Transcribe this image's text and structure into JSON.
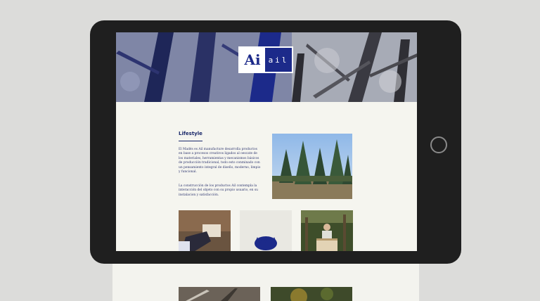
{
  "logo": {
    "mark": "Ai",
    "wordmark": "ail"
  },
  "section": {
    "heading": "Lifestyle",
    "paragraph_1": "El Madés es Ail manufacture desarrolla productos en base a procesos creativos ligados al oescate de los materiales, herramientas y mecanismos básicos de producción tradicional, todo esto conminado con un pensamiento integral de diseño, moderno, limpio y funcional.",
    "paragraph_2": "La construcción de los productos Ail contempla la interacción del objeto con su propio usuario, en su instalacion y satisfacción."
  },
  "colors": {
    "brand_blue": "#1c2a8a",
    "page_bg": "#f5f5ef",
    "tablet": "#1f1f1f"
  },
  "images": {
    "hero": "forest-canopy-duotone",
    "feature": "pine-forest-photo",
    "thumb_1": "hands-holding-wood-box",
    "thumb_2": "blue-logo-stamp",
    "thumb_3": "man-with-wood-crate"
  }
}
